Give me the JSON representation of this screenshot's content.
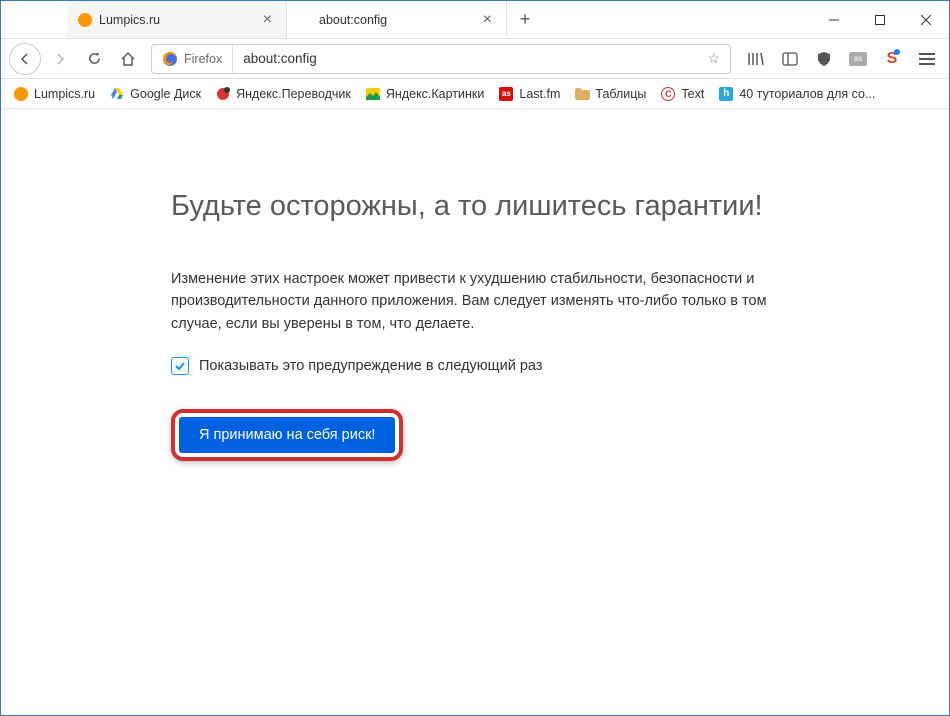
{
  "tabs": [
    {
      "label": "Lumpics.ru"
    },
    {
      "label": "about:config"
    }
  ],
  "urlbar": {
    "identity_label": "Firefox",
    "url": "about:config"
  },
  "bookmarks": [
    {
      "label": "Lumpics.ru"
    },
    {
      "label": "Google Диск"
    },
    {
      "label": "Яндекс.Переводчик"
    },
    {
      "label": "Яндекс.Картинки"
    },
    {
      "label": "Last.fm"
    },
    {
      "label": "Таблицы"
    },
    {
      "label": "Text"
    },
    {
      "label": "40 туториалов для со..."
    }
  ],
  "warning": {
    "heading": "Будьте осторожны, а то лишитесь гарантии!",
    "body": "Изменение этих настроек может привести к ухудшению стабильности, безопасности и производительности данного приложения. Вам следует изменять что-либо только в том случае, если вы уверены в том, что делаете.",
    "checkbox_label": "Показывать это предупреждение в следующий раз",
    "accept_label": "Я принимаю на себя риск!"
  }
}
